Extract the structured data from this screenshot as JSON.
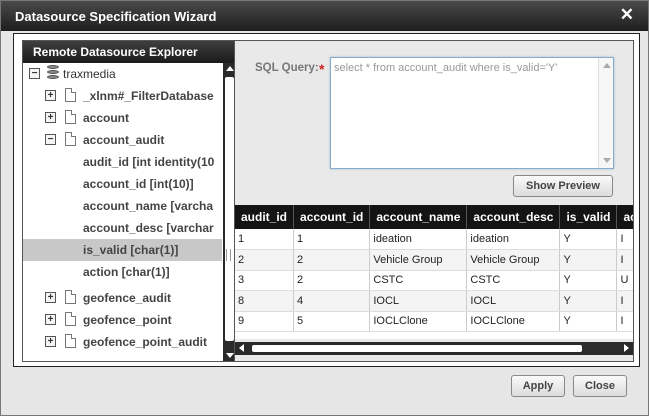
{
  "window": {
    "title": "Datasource Specification Wizard",
    "close_glyph": "✕"
  },
  "explorer": {
    "title": "Remote Datasource Explorer",
    "items": [
      {
        "label": "traxmedia",
        "kind": "database",
        "expand": "−"
      },
      {
        "label": "_xlnm#_FilterDatabase",
        "kind": "table",
        "expand": "+"
      },
      {
        "label": "account",
        "kind": "table",
        "expand": "+"
      },
      {
        "label": "account_audit",
        "kind": "table",
        "expand": "−"
      },
      {
        "label": "audit_id [int identity(10",
        "kind": "column"
      },
      {
        "label": "account_id [int(10)]",
        "kind": "column"
      },
      {
        "label": "account_name [varcha",
        "kind": "column"
      },
      {
        "label": "account_desc [varchar",
        "kind": "column"
      },
      {
        "label": "is_valid [char(1)]",
        "kind": "column",
        "selected": true
      },
      {
        "label": "action [char(1)]",
        "kind": "column"
      },
      {
        "label": "geofence_audit",
        "kind": "table",
        "expand": "+"
      },
      {
        "label": "geofence_point",
        "kind": "table",
        "expand": "+"
      },
      {
        "label": "geofence_point_audit",
        "kind": "table",
        "expand": "+"
      }
    ]
  },
  "query": {
    "label": "SQL Query:",
    "required_mark": "*",
    "value": "select * from account_audit where is_valid='Y'"
  },
  "preview_button": "Show Preview",
  "results": {
    "columns": [
      "audit_id",
      "account_id",
      "account_name",
      "account_desc",
      "is_valid",
      "action"
    ],
    "rows": [
      [
        "1",
        "1",
        "ideation",
        "ideation",
        "Y",
        "I"
      ],
      [
        "2",
        "2",
        "Vehicle Group",
        "Vehicle Group",
        "Y",
        "I"
      ],
      [
        "3",
        "2",
        "CSTC",
        "CSTC",
        "Y",
        "U"
      ],
      [
        "8",
        "4",
        "IOCL",
        "IOCL",
        "Y",
        "I"
      ],
      [
        "9",
        "5",
        "IOCLClone",
        "IOCLClone",
        "Y",
        "I"
      ]
    ]
  },
  "footer": {
    "apply_label": "Apply",
    "close_label": "Close"
  }
}
